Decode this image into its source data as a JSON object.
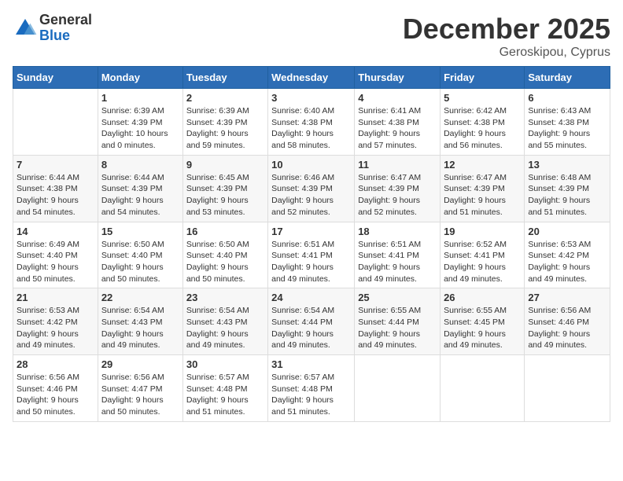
{
  "logo": {
    "general": "General",
    "blue": "Blue"
  },
  "title": "December 2025",
  "subtitle": "Geroskipou, Cyprus",
  "days_of_week": [
    "Sunday",
    "Monday",
    "Tuesday",
    "Wednesday",
    "Thursday",
    "Friday",
    "Saturday"
  ],
  "weeks": [
    [
      {
        "day": "",
        "info": ""
      },
      {
        "day": "1",
        "info": "Sunrise: 6:39 AM\nSunset: 4:39 PM\nDaylight: 10 hours\nand 0 minutes."
      },
      {
        "day": "2",
        "info": "Sunrise: 6:39 AM\nSunset: 4:39 PM\nDaylight: 9 hours\nand 59 minutes."
      },
      {
        "day": "3",
        "info": "Sunrise: 6:40 AM\nSunset: 4:38 PM\nDaylight: 9 hours\nand 58 minutes."
      },
      {
        "day": "4",
        "info": "Sunrise: 6:41 AM\nSunset: 4:38 PM\nDaylight: 9 hours\nand 57 minutes."
      },
      {
        "day": "5",
        "info": "Sunrise: 6:42 AM\nSunset: 4:38 PM\nDaylight: 9 hours\nand 56 minutes."
      },
      {
        "day": "6",
        "info": "Sunrise: 6:43 AM\nSunset: 4:38 PM\nDaylight: 9 hours\nand 55 minutes."
      }
    ],
    [
      {
        "day": "7",
        "info": "Sunrise: 6:44 AM\nSunset: 4:38 PM\nDaylight: 9 hours\nand 54 minutes."
      },
      {
        "day": "8",
        "info": "Sunrise: 6:44 AM\nSunset: 4:39 PM\nDaylight: 9 hours\nand 54 minutes."
      },
      {
        "day": "9",
        "info": "Sunrise: 6:45 AM\nSunset: 4:39 PM\nDaylight: 9 hours\nand 53 minutes."
      },
      {
        "day": "10",
        "info": "Sunrise: 6:46 AM\nSunset: 4:39 PM\nDaylight: 9 hours\nand 52 minutes."
      },
      {
        "day": "11",
        "info": "Sunrise: 6:47 AM\nSunset: 4:39 PM\nDaylight: 9 hours\nand 52 minutes."
      },
      {
        "day": "12",
        "info": "Sunrise: 6:47 AM\nSunset: 4:39 PM\nDaylight: 9 hours\nand 51 minutes."
      },
      {
        "day": "13",
        "info": "Sunrise: 6:48 AM\nSunset: 4:39 PM\nDaylight: 9 hours\nand 51 minutes."
      }
    ],
    [
      {
        "day": "14",
        "info": "Sunrise: 6:49 AM\nSunset: 4:40 PM\nDaylight: 9 hours\nand 50 minutes."
      },
      {
        "day": "15",
        "info": "Sunrise: 6:50 AM\nSunset: 4:40 PM\nDaylight: 9 hours\nand 50 minutes."
      },
      {
        "day": "16",
        "info": "Sunrise: 6:50 AM\nSunset: 4:40 PM\nDaylight: 9 hours\nand 50 minutes."
      },
      {
        "day": "17",
        "info": "Sunrise: 6:51 AM\nSunset: 4:41 PM\nDaylight: 9 hours\nand 49 minutes."
      },
      {
        "day": "18",
        "info": "Sunrise: 6:51 AM\nSunset: 4:41 PM\nDaylight: 9 hours\nand 49 minutes."
      },
      {
        "day": "19",
        "info": "Sunrise: 6:52 AM\nSunset: 4:41 PM\nDaylight: 9 hours\nand 49 minutes."
      },
      {
        "day": "20",
        "info": "Sunrise: 6:53 AM\nSunset: 4:42 PM\nDaylight: 9 hours\nand 49 minutes."
      }
    ],
    [
      {
        "day": "21",
        "info": "Sunrise: 6:53 AM\nSunset: 4:42 PM\nDaylight: 9 hours\nand 49 minutes."
      },
      {
        "day": "22",
        "info": "Sunrise: 6:54 AM\nSunset: 4:43 PM\nDaylight: 9 hours\nand 49 minutes."
      },
      {
        "day": "23",
        "info": "Sunrise: 6:54 AM\nSunset: 4:43 PM\nDaylight: 9 hours\nand 49 minutes."
      },
      {
        "day": "24",
        "info": "Sunrise: 6:54 AM\nSunset: 4:44 PM\nDaylight: 9 hours\nand 49 minutes."
      },
      {
        "day": "25",
        "info": "Sunrise: 6:55 AM\nSunset: 4:44 PM\nDaylight: 9 hours\nand 49 minutes."
      },
      {
        "day": "26",
        "info": "Sunrise: 6:55 AM\nSunset: 4:45 PM\nDaylight: 9 hours\nand 49 minutes."
      },
      {
        "day": "27",
        "info": "Sunrise: 6:56 AM\nSunset: 4:46 PM\nDaylight: 9 hours\nand 49 minutes."
      }
    ],
    [
      {
        "day": "28",
        "info": "Sunrise: 6:56 AM\nSunset: 4:46 PM\nDaylight: 9 hours\nand 50 minutes."
      },
      {
        "day": "29",
        "info": "Sunrise: 6:56 AM\nSunset: 4:47 PM\nDaylight: 9 hours\nand 50 minutes."
      },
      {
        "day": "30",
        "info": "Sunrise: 6:57 AM\nSunset: 4:48 PM\nDaylight: 9 hours\nand 51 minutes."
      },
      {
        "day": "31",
        "info": "Sunrise: 6:57 AM\nSunset: 4:48 PM\nDaylight: 9 hours\nand 51 minutes."
      },
      {
        "day": "",
        "info": ""
      },
      {
        "day": "",
        "info": ""
      },
      {
        "day": "",
        "info": ""
      }
    ]
  ]
}
